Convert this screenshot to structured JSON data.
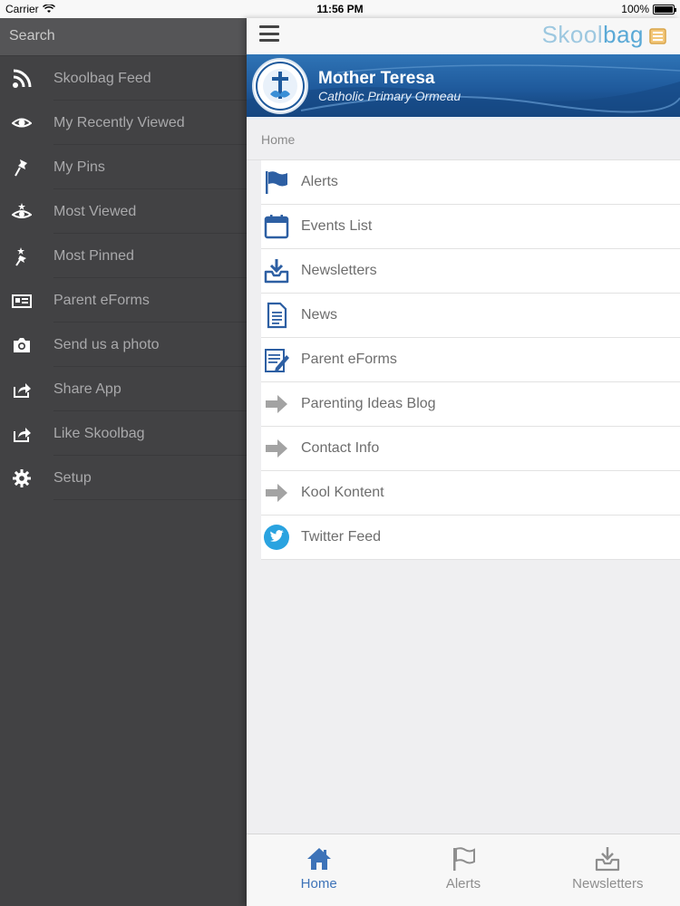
{
  "status_bar": {
    "carrier": "Carrier",
    "time": "11:56 PM",
    "battery": "100%",
    "battery_level": 1.0
  },
  "sidebar": {
    "search_placeholder": "Search",
    "items": [
      {
        "label": "Skoolbag Feed",
        "icon": "rss-icon"
      },
      {
        "label": "My Recently Viewed",
        "icon": "eye-icon"
      },
      {
        "label": "My Pins",
        "icon": "pin-icon"
      },
      {
        "label": "Most Viewed",
        "icon": "eye-star-icon"
      },
      {
        "label": "Most Pinned",
        "icon": "pin-star-icon"
      },
      {
        "label": "Parent eForms",
        "icon": "id-card-icon"
      },
      {
        "label": "Send us a photo",
        "icon": "camera-icon"
      },
      {
        "label": "Share App",
        "icon": "share-icon"
      },
      {
        "label": "Like Skoolbag",
        "icon": "share-icon"
      },
      {
        "label": "Setup",
        "icon": "gear-icon"
      }
    ]
  },
  "header": {
    "brand_part1": "Skool",
    "brand_part2": "bag"
  },
  "banner": {
    "school_name": "Mother Teresa",
    "school_subtitle": "Catholic Primary Ormeau"
  },
  "breadcrumb": "Home",
  "menu": {
    "items": [
      {
        "label": "Alerts",
        "icon": "flag-icon"
      },
      {
        "label": "Events List",
        "icon": "calendar-icon"
      },
      {
        "label": "Newsletters",
        "icon": "inbox-download-icon"
      },
      {
        "label": "News",
        "icon": "document-icon"
      },
      {
        "label": "Parent eForms",
        "icon": "form-edit-icon"
      },
      {
        "label": "Parenting Ideas Blog",
        "icon": "arrow-right-icon"
      },
      {
        "label": "Contact Info",
        "icon": "arrow-right-icon"
      },
      {
        "label": "Kool Kontent",
        "icon": "arrow-right-icon"
      },
      {
        "label": "Twitter Feed",
        "icon": "twitter-icon"
      }
    ]
  },
  "tabbar": {
    "tabs": [
      {
        "label": "Home",
        "icon": "home-icon",
        "active": true
      },
      {
        "label": "Alerts",
        "icon": "flag-icon",
        "active": false
      },
      {
        "label": "Newsletters",
        "icon": "inbox-download-icon",
        "active": false
      }
    ]
  },
  "colors": {
    "accent": "#3d73b8",
    "sidebar_bg": "#424244",
    "banner_blue": "#1f5a9c",
    "twitter": "#2aa3e0"
  }
}
